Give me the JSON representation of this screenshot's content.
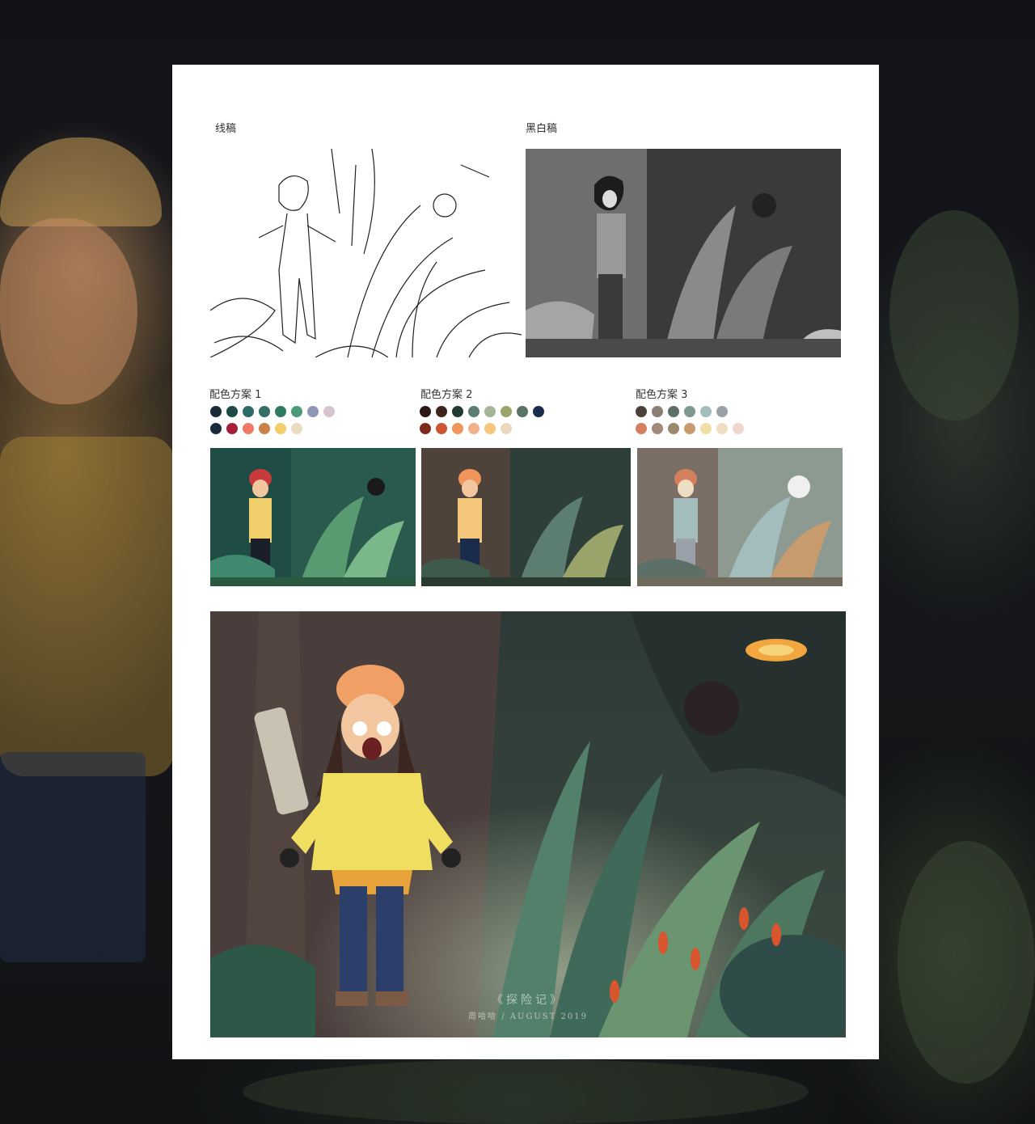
{
  "sections": {
    "lineart_label": "线稿",
    "grayscale_label": "黑白稿"
  },
  "schemes": [
    {
      "label": "配色方案 1",
      "row1": [
        "#1b2a35",
        "#1e4a45",
        "#2e6a68",
        "#356e66",
        "#2f7a63",
        "#4c9a7a",
        "#8b96b8",
        "#d6c5cf"
      ],
      "row2": [
        "#1a2b3d",
        "#a51f3a",
        "#ee7b63",
        "#c8824a",
        "#f0cf6b",
        "#eadcc0"
      ]
    },
    {
      "label": "配色方案 2",
      "row1": [
        "#2b1714",
        "#3d241c",
        "#233a33",
        "#5b7e70",
        "#a5b697",
        "#9aa46a",
        "#5a7366",
        "#1a2c4e"
      ],
      "row2": [
        "#7f2a1e",
        "#cc5634",
        "#f0965c",
        "#f2b08a",
        "#f4c77c",
        "#ead9bf"
      ]
    },
    {
      "label": "配色方案 3",
      "row1": [
        "#4a4238",
        "#8b7f72",
        "#5c7068",
        "#7f9890",
        "#a3bcbc",
        "#9aa1a8"
      ],
      "row2": [
        "#d4805f",
        "#a18a78",
        "#9c8a6f",
        "#c79b6e",
        "#f1dfa7",
        "#f0dec3",
        "#efd6cf"
      ]
    }
  ],
  "final": {
    "title": "《探险记》",
    "credit": "周哈哈 / AUGUST 2019"
  }
}
